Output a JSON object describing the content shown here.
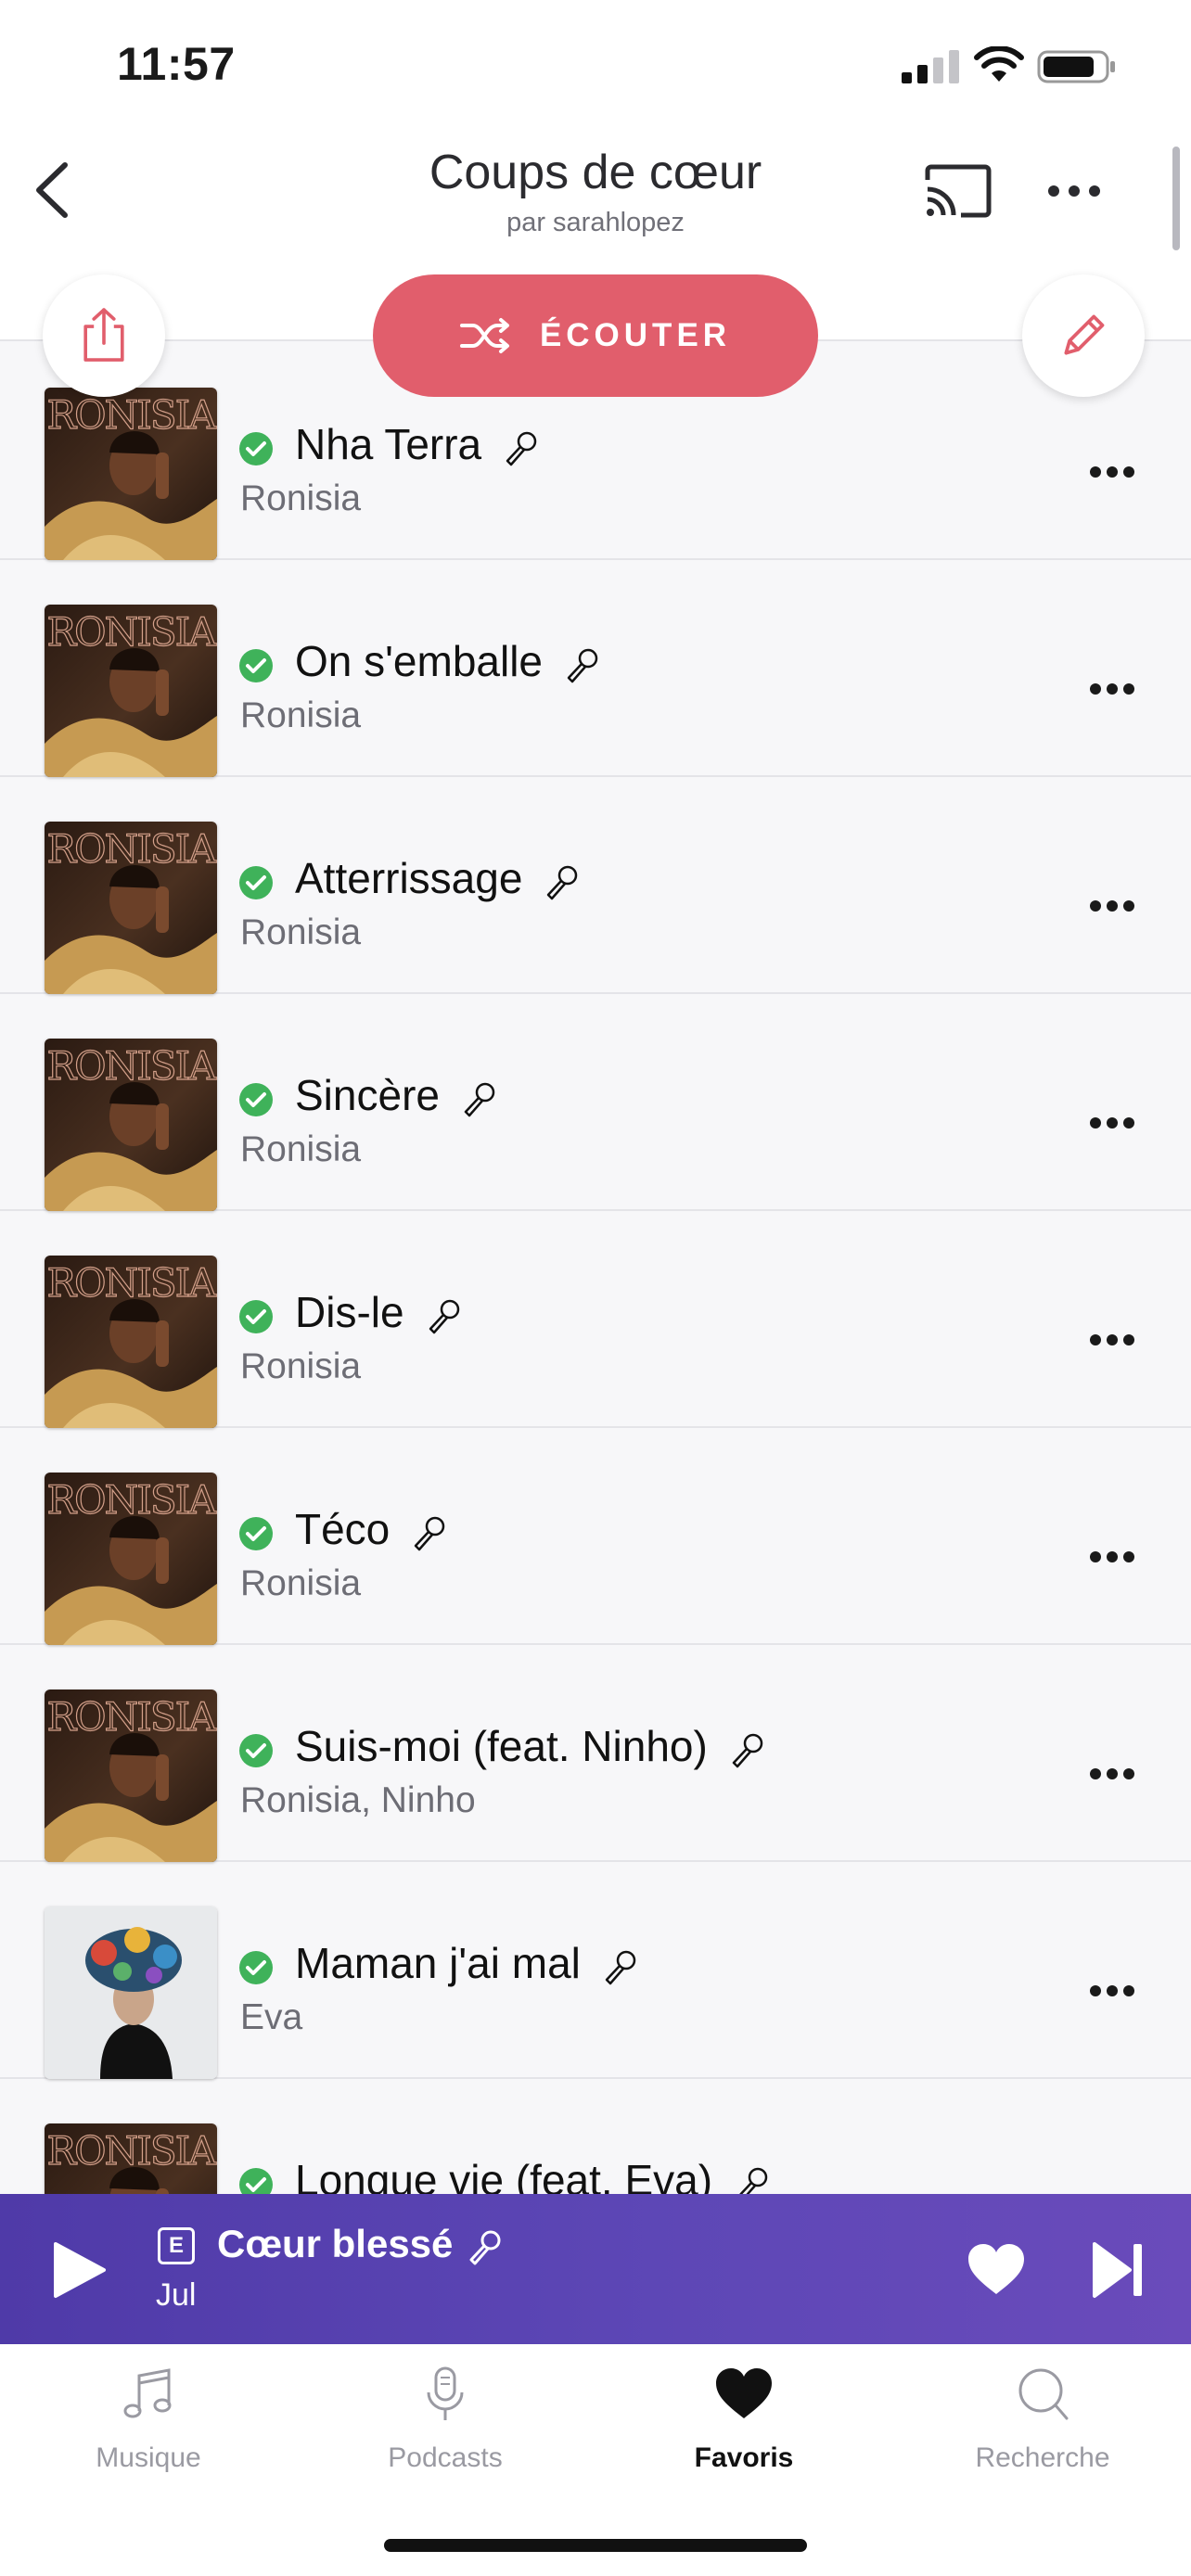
{
  "status_bar": {
    "time": "11:57"
  },
  "header": {
    "title": "Coups de cœur",
    "subtitle": "par sarahlopez",
    "back_icon": "chevron-left-icon",
    "cast_icon": "cast-icon",
    "more_icon": "more-horizontal-icon"
  },
  "actions": {
    "listen_label": "ÉCOUTER",
    "share_icon": "share-icon",
    "edit_icon": "pencil-icon",
    "shuffle_icon": "shuffle-icon"
  },
  "tracks": [
    {
      "title": "Nha Terra",
      "artist": "Ronisia",
      "cover": "ronisia"
    },
    {
      "title": "On s'emballe",
      "artist": "Ronisia",
      "cover": "ronisia"
    },
    {
      "title": "Atterrissage",
      "artist": "Ronisia",
      "cover": "ronisia"
    },
    {
      "title": "Sincère",
      "artist": "Ronisia",
      "cover": "ronisia"
    },
    {
      "title": "Dis-le",
      "artist": "Ronisia",
      "cover": "ronisia"
    },
    {
      "title": "Téco",
      "artist": "Ronisia",
      "cover": "ronisia"
    },
    {
      "title": "Suis-moi (feat. Ninho)",
      "artist": "Ronisia, Ninho",
      "cover": "ronisia"
    },
    {
      "title": "Maman j'ai mal",
      "artist": "Eva",
      "cover": "eva"
    },
    {
      "title": "Longue vie (feat. Eva)",
      "artist": "",
      "cover": "ronisia"
    }
  ],
  "cover_art": {
    "ronisia_text": "RONISIA"
  },
  "mini_player": {
    "explicit_badge": "E",
    "title": "Cœur blessé",
    "artist": "Jul"
  },
  "tabbar": {
    "tabs": [
      {
        "label": "Musique",
        "icon": "music-note-icon",
        "active": false
      },
      {
        "label": "Podcasts",
        "icon": "microphone-icon",
        "active": false
      },
      {
        "label": "Favoris",
        "icon": "heart-icon",
        "active": true
      },
      {
        "label": "Recherche",
        "icon": "search-icon",
        "active": false
      }
    ]
  },
  "colors": {
    "accent": "#e15e6c",
    "player_gradient_start": "#4f3aa8",
    "player_gradient_end": "#6a4bbb",
    "download_check": "#3fb25a"
  }
}
